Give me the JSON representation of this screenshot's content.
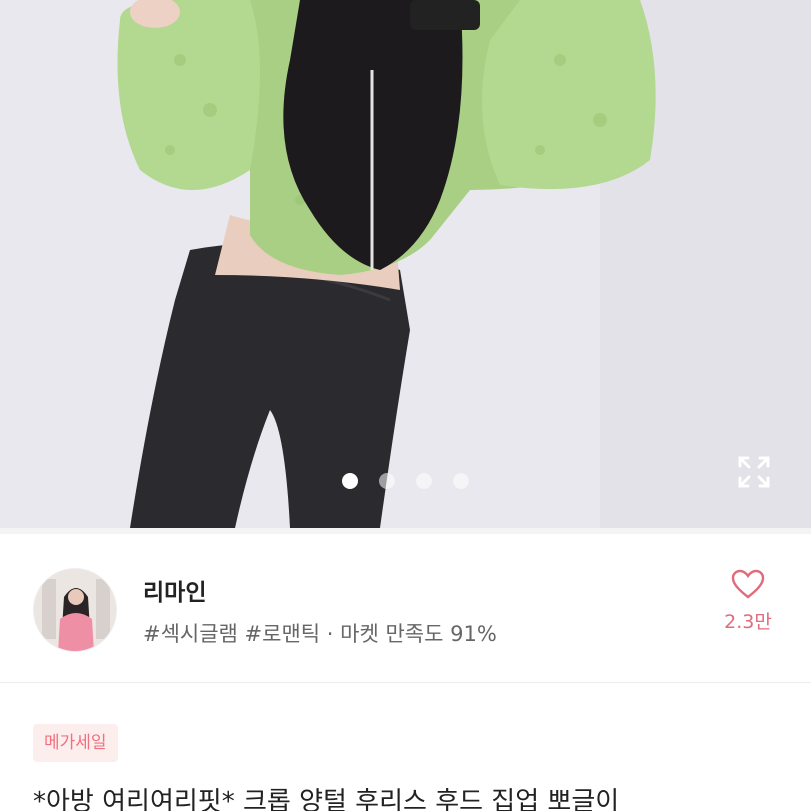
{
  "product_image": {
    "icon": "expand-icon",
    "carousel_dots": 4,
    "active_dot_index": 0
  },
  "seller": {
    "name": "리마인",
    "tags": "#섹시글램 #로맨틱",
    "separator": "·",
    "satisfaction": "마켓 만족도 91%"
  },
  "like": {
    "icon": "heart-icon",
    "count": "2.3만"
  },
  "product": {
    "badge": "메가세일",
    "title": "*아방 여리여리핏* 크롭 양털 후리스 후드 집업 뽀글이"
  },
  "colors": {
    "accent_pink": "#e06b7c",
    "badge_bg": "#fdeeee",
    "badge_text": "#f07080"
  }
}
